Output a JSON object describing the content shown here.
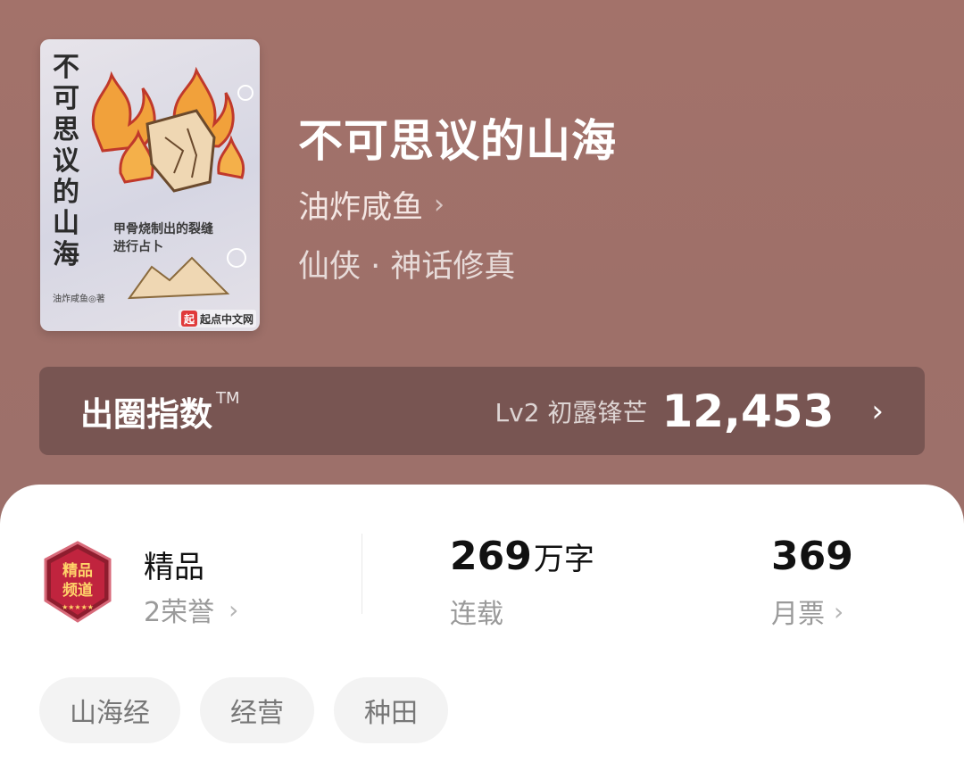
{
  "book": {
    "cover": {
      "vertical_title": "不可思议的山海",
      "tagline": "甲骨烧制出的裂缝进行占卜",
      "author_mark": "油炸咸鱼◎著",
      "brand_icon": "起",
      "brand_text": "起点中文网"
    },
    "title": "不可思议的山海",
    "author": "油炸咸鱼",
    "genre": "仙侠 · 神话修真"
  },
  "index": {
    "label": "出圈指数",
    "tm": "TM",
    "level": "Lv2 初露锋芒",
    "value": "12,453"
  },
  "stats": {
    "quality": {
      "badge_text": "精品频道",
      "title": "精品",
      "honors": "2荣誉"
    },
    "words": {
      "number": "269",
      "unit": "万字",
      "status": "连载"
    },
    "votes": {
      "number": "369",
      "label": "月票"
    }
  },
  "tags": [
    "山海经",
    "经营",
    "种田"
  ],
  "icons": {
    "chevron": "chevron-right-icon",
    "badge": "premium-channel-badge-icon"
  },
  "colors": {
    "header_bg": "#a3726a",
    "index_bar": "#785552",
    "card_bg": "#ffffff",
    "tag_bg": "#f3f3f3"
  }
}
